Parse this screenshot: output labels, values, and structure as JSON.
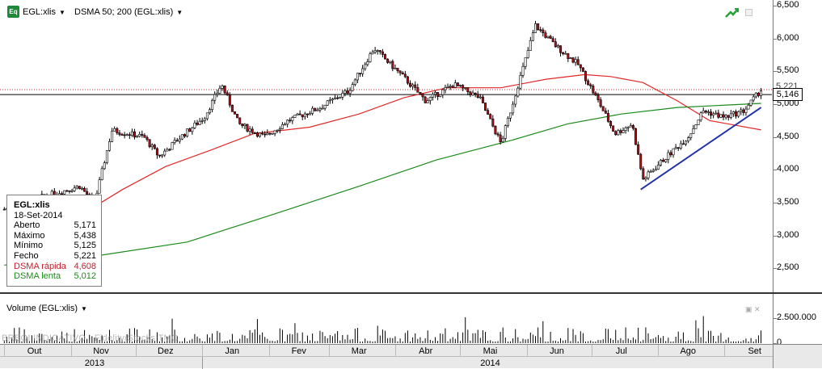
{
  "toolbar": {
    "ticker_icon": "Eq",
    "ticker": "EGL:xlis",
    "indicator": "DSMA 50; 200 (EGL:xlis)"
  },
  "price_label": "5,146",
  "price_label_2": "5,221",
  "volume_panel": {
    "title": "Volume (EGL:xlis)",
    "ticks": [
      "2.500.000",
      "0"
    ]
  },
  "watermark": "BREOI INDICATIVO · Fidelity/Stocks TMC",
  "time_axis": {
    "months": [
      "Out",
      "Nov",
      "Dez",
      "Jan",
      "Fev",
      "Mar",
      "Abr",
      "Mai",
      "Jun",
      "Jul",
      "Ago",
      "Set"
    ],
    "years": [
      "2013",
      "2014"
    ]
  },
  "infobox": {
    "title": "EGL:xlis",
    "date": "18-Set-2014",
    "rows": [
      {
        "label": "Aberto",
        "value": "5,171"
      },
      {
        "label": "Máximo",
        "value": "5,438"
      },
      {
        "label": "Mínimo",
        "value": "5,125"
      },
      {
        "label": "Fecho",
        "value": "5,221"
      },
      {
        "label": "DSMA rápida",
        "value": "4,608"
      },
      {
        "label": "DSMA lenta",
        "value": "5,012"
      }
    ]
  },
  "colors": {
    "bull": "#ffffff",
    "bear": "#b0101a",
    "outline": "#000000",
    "sma_fast": "#e02828",
    "sma_slow": "#1a8a1a",
    "trendline": "#2233a8"
  },
  "chart_data": {
    "type": "candlestick",
    "title": "",
    "y_axis": {
      "min": 2000,
      "max": 6500,
      "ticks": [
        "6,500",
        "6,000",
        "5,500",
        "5,000",
        "4,500",
        "4,000",
        "3,500",
        "3,000",
        "2,500"
      ]
    },
    "horizontal_lines": [
      5146,
      5221
    ],
    "trendline": {
      "from": [
        "2014-07-24",
        3700
      ],
      "to": [
        "2014-09-18",
        4950
      ]
    },
    "price_anchors": [
      {
        "date": "2013-10-01",
        "close": 3400
      },
      {
        "date": "2013-10-20",
        "close": 3600
      },
      {
        "date": "2013-11-05",
        "close": 3750
      },
      {
        "date": "2013-11-12",
        "close": 3500
      },
      {
        "date": "2013-11-20",
        "close": 4600
      },
      {
        "date": "2013-11-28",
        "close": 4550
      },
      {
        "date": "2013-12-05",
        "close": 4500
      },
      {
        "date": "2013-12-12",
        "close": 4200
      },
      {
        "date": "2013-12-22",
        "close": 4500
      },
      {
        "date": "2014-01-02",
        "close": 4800
      },
      {
        "date": "2014-01-10",
        "close": 5300
      },
      {
        "date": "2014-01-18",
        "close": 4700
      },
      {
        "date": "2014-01-30",
        "close": 4500
      },
      {
        "date": "2014-02-10",
        "close": 4750
      },
      {
        "date": "2014-02-25",
        "close": 4950
      },
      {
        "date": "2014-03-10",
        "close": 5200
      },
      {
        "date": "2014-03-22",
        "close": 5850
      },
      {
        "date": "2014-04-05",
        "close": 5400
      },
      {
        "date": "2014-04-15",
        "close": 5050
      },
      {
        "date": "2014-04-28",
        "close": 5300
      },
      {
        "date": "2014-05-10",
        "close": 5100
      },
      {
        "date": "2014-05-20",
        "close": 4400
      },
      {
        "date": "2014-05-28",
        "close": 5300
      },
      {
        "date": "2014-06-05",
        "close": 6200
      },
      {
        "date": "2014-06-14",
        "close": 5900
      },
      {
        "date": "2014-06-25",
        "close": 5600
      },
      {
        "date": "2014-07-05",
        "close": 5000
      },
      {
        "date": "2014-07-12",
        "close": 4550
      },
      {
        "date": "2014-07-20",
        "close": 4700
      },
      {
        "date": "2014-07-25",
        "close": 3850
      },
      {
        "date": "2014-08-05",
        "close": 4200
      },
      {
        "date": "2014-08-15",
        "close": 4500
      },
      {
        "date": "2014-08-22",
        "close": 4900
      },
      {
        "date": "2014-09-01",
        "close": 4800
      },
      {
        "date": "2014-09-10",
        "close": 4900
      },
      {
        "date": "2014-09-18",
        "close": 5221
      }
    ],
    "series": [
      {
        "name": "DSMA rápida",
        "points": [
          {
            "date": "2013-11-10",
            "value": 3400
          },
          {
            "date": "2013-11-25",
            "value": 3700
          },
          {
            "date": "2013-12-15",
            "value": 4050
          },
          {
            "date": "2014-01-05",
            "value": 4300
          },
          {
            "date": "2014-01-25",
            "value": 4550
          },
          {
            "date": "2014-02-20",
            "value": 4650
          },
          {
            "date": "2014-03-15",
            "value": 4850
          },
          {
            "date": "2014-04-05",
            "value": 5100
          },
          {
            "date": "2014-04-25",
            "value": 5250
          },
          {
            "date": "2014-05-20",
            "value": 5250
          },
          {
            "date": "2014-06-10",
            "value": 5380
          },
          {
            "date": "2014-06-28",
            "value": 5450
          },
          {
            "date": "2014-07-10",
            "value": 5420
          },
          {
            "date": "2014-07-25",
            "value": 5330
          },
          {
            "date": "2014-08-10",
            "value": 5050
          },
          {
            "date": "2014-08-25",
            "value": 4750
          },
          {
            "date": "2014-09-18",
            "value": 4608
          }
        ]
      },
      {
        "name": "DSMA lenta",
        "points": [
          {
            "date": "2013-10-01",
            "value": 2550
          },
          {
            "date": "2013-11-15",
            "value": 2700
          },
          {
            "date": "2013-12-25",
            "value": 2900
          },
          {
            "date": "2014-02-01",
            "value": 3300
          },
          {
            "date": "2014-03-15",
            "value": 3750
          },
          {
            "date": "2014-04-20",
            "value": 4150
          },
          {
            "date": "2014-05-25",
            "value": 4450
          },
          {
            "date": "2014-06-20",
            "value": 4700
          },
          {
            "date": "2014-07-15",
            "value": 4850
          },
          {
            "date": "2014-08-10",
            "value": 4950
          },
          {
            "date": "2014-09-18",
            "value": 5012
          }
        ]
      }
    ]
  }
}
